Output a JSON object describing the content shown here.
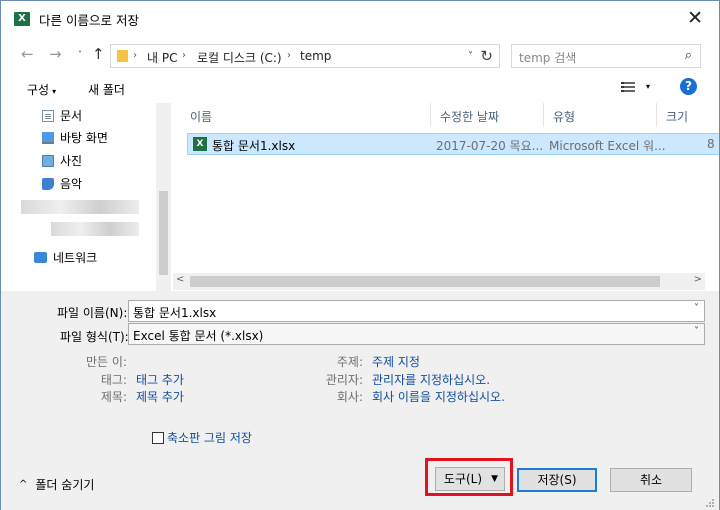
{
  "window": {
    "title": "다른 이름으로 저장",
    "app_icon": "X",
    "close_glyph": "✕"
  },
  "nav": {
    "back_glyph": "←",
    "forward_glyph": "→",
    "history_glyph": "˅",
    "up_glyph": "↑",
    "breadcrumbs": [
      "내 PC",
      "로컬 디스크 (C:)",
      "temp"
    ],
    "separator": "›",
    "dropdown_glyph": "˅",
    "refresh_glyph": "↻",
    "search_placeholder": "temp 검색",
    "search_glyph": "⌕"
  },
  "toolbar": {
    "organize_label": "구성",
    "organize_arrow": "▾",
    "new_folder_label": "새 폴더",
    "view_dropdown": "▾",
    "help_label": "?"
  },
  "navpane": {
    "items": [
      {
        "label": "문서",
        "icon": "document-icon"
      },
      {
        "label": "바탕 화면",
        "icon": "desktop-icon"
      },
      {
        "label": "사진",
        "icon": "pictures-icon"
      },
      {
        "label": "음악",
        "icon": "music-icon"
      }
    ],
    "network_label": "네트워크"
  },
  "filelist": {
    "columns": [
      "이름",
      "수정한 날짜",
      "유형",
      "크기"
    ],
    "sort_glyph": "˄",
    "rows": [
      {
        "icon": "X",
        "name": "통합 문서1.xlsx",
        "modified": "2017-07-20 목요...",
        "type": "Microsoft Excel 워...",
        "size": "8"
      }
    ],
    "scroll_left": "<",
    "scroll_right": ">"
  },
  "form": {
    "filename_label": "파일 이름(N):",
    "filename_value": "통합 문서1.xlsx",
    "filetype_label": "파일 형식(T):",
    "filetype_value": "Excel 통합 문서 (*.xlsx)",
    "combo_glyph": "˅",
    "authors_label": "만든 이:",
    "tags_label": "태그:",
    "tags_value": "태그 추가",
    "title_label": "제목:",
    "title_value": "제목 추가",
    "subject_label": "주제:",
    "subject_value": "주제 지정",
    "manager_label": "관리자:",
    "manager_value": "관리자를 지정하십시오.",
    "company_label": "회사:",
    "company_value": "회사 이름을 지정하십시오.",
    "thumbnail_label": "축소판 그림 저장",
    "thumbnail_checked": false
  },
  "footer": {
    "hide_folders_glyph": "^",
    "hide_folders_label": "폴더 숨기기",
    "tools_label": "도구(L)",
    "tools_dropdown": "▼",
    "save_label": "저장(S)",
    "cancel_label": "취소"
  },
  "colors": {
    "highlight_box": "#e0141e",
    "selection": "#cce8ff",
    "link": "#0f4d9e",
    "save_border": "#1f7bd8"
  }
}
